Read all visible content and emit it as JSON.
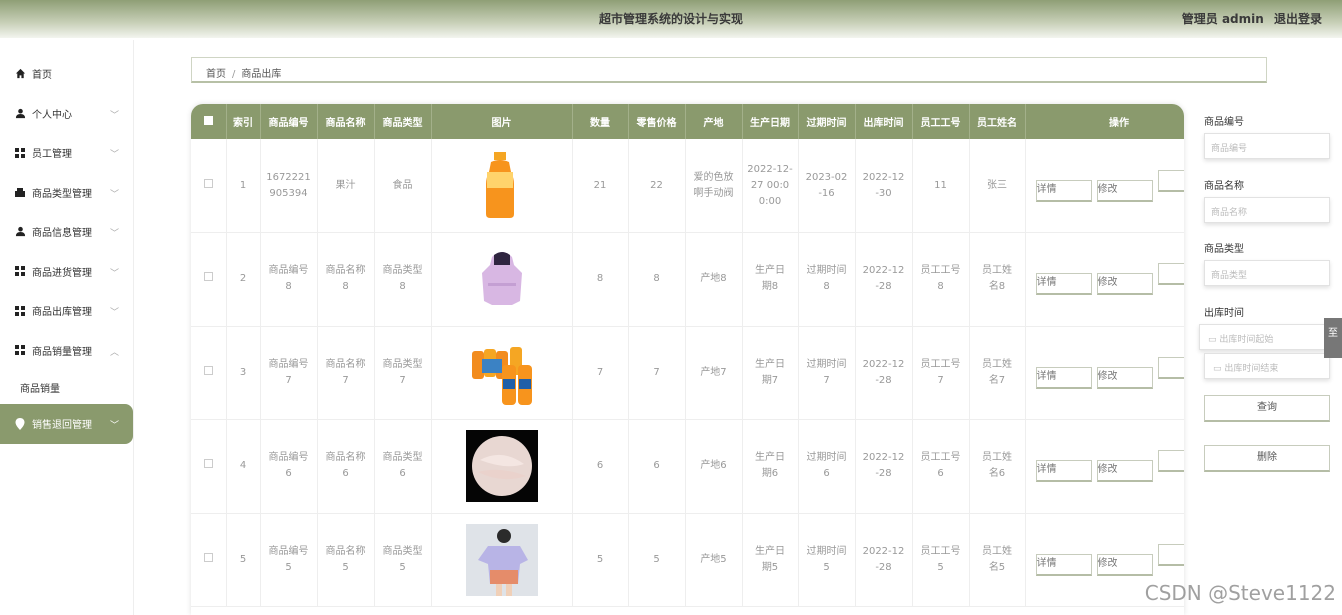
{
  "header": {
    "title": "超市管理系统的设计与实现",
    "user": "管理员 admin",
    "logout": "退出登录"
  },
  "sidebar": {
    "items": [
      {
        "label": "首页",
        "icon": "home-icon"
      },
      {
        "label": "个人中心",
        "icon": "user-icon"
      },
      {
        "label": "员工管理",
        "icon": "grid-icon"
      },
      {
        "label": "商品类型管理",
        "icon": "grid-icon"
      },
      {
        "label": "商品信息管理",
        "icon": "user-icon"
      },
      {
        "label": "商品进货管理",
        "icon": "grid-icon"
      },
      {
        "label": "商品出库管理",
        "icon": "grid-icon"
      },
      {
        "label": "商品销量管理",
        "icon": "grid-icon"
      }
    ],
    "sub_item": "商品销量",
    "active_item": "销售退回管理"
  },
  "breadcrumb": {
    "home": "首页",
    "current": "商品出库"
  },
  "table": {
    "headers": [
      "索引",
      "商品编号",
      "商品名称",
      "商品类型",
      "图片",
      "数量",
      "零售价格",
      "产地",
      "生产日期",
      "过期时间",
      "出库时间",
      "员工工号",
      "员工姓名",
      "操作"
    ],
    "rows": [
      {
        "idx": "1",
        "code": "1672221905394",
        "name": "果汁",
        "type": "食品",
        "pic": "juice-bottle",
        "qty": "21",
        "price": "22",
        "origin": "爱的色放啊手动阀",
        "mfg": "2022-12-27 00:00:00",
        "expire": "2023-02-16",
        "out": "2022-12-30",
        "emp_no": "11",
        "emp_name": "张三"
      },
      {
        "idx": "2",
        "code": "商品编号8",
        "name": "商品名称8",
        "type": "商品类型8",
        "pic": "purple-jacket",
        "qty": "8",
        "price": "8",
        "origin": "产地8",
        "mfg": "生产日期8",
        "expire": "过期时间8",
        "out": "2022-12-28",
        "emp_no": "员工工号8",
        "emp_name": "员工姓名8"
      },
      {
        "idx": "3",
        "code": "商品编号7",
        "name": "商品名称7",
        "type": "商品类型7",
        "pic": "orange-drinks",
        "qty": "7",
        "price": "7",
        "origin": "产地7",
        "mfg": "生产日期7",
        "expire": "过期时间7",
        "out": "2022-12-28",
        "emp_no": "员工工号7",
        "emp_name": "员工姓名7"
      },
      {
        "idx": "4",
        "code": "商品编号6",
        "name": "商品名称6",
        "type": "商品类型6",
        "pic": "fish-plate",
        "qty": "6",
        "price": "6",
        "origin": "产地6",
        "mfg": "生产日期6",
        "expire": "过期时间6",
        "out": "2022-12-28",
        "emp_no": "员工工号6",
        "emp_name": "员工姓名6"
      },
      {
        "idx": "5",
        "code": "商品编号5",
        "name": "商品名称5",
        "type": "商品类型5",
        "pic": "tshirt-person",
        "qty": "5",
        "price": "5",
        "origin": "产地5",
        "mfg": "生产日期5",
        "expire": "过期时间5",
        "out": "2022-12-28",
        "emp_no": "员工工号5",
        "emp_name": "员工姓名5"
      }
    ],
    "btn_detail": "详情",
    "btn_edit": "修改"
  },
  "search": {
    "code_label": "商品编号",
    "code_placeholder": "商品编号",
    "name_label": "商品名称",
    "name_placeholder": "商品名称",
    "type_label": "商品类型",
    "type_placeholder": "商品类型",
    "time_label": "出库时间",
    "time_start": "出库时间起始",
    "time_end": "出库时间结束",
    "query": "查询",
    "delete": "删除"
  },
  "side_tab": "至",
  "watermark": "CSDN @Steve1122",
  "colors": {
    "accent": "#8a9a6d"
  }
}
